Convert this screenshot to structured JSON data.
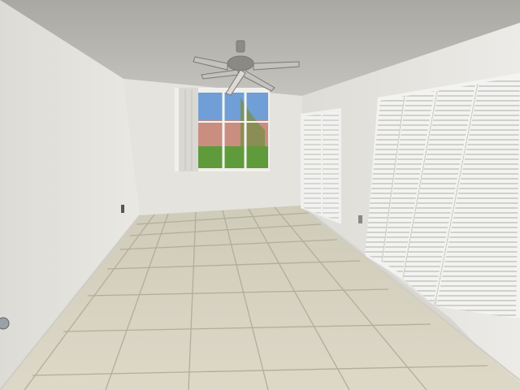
{
  "scene": {
    "ceiling_color": "#b9b8b3",
    "wall_color": "#e6e5e0",
    "wall_shadow_color": "#d4d3ce",
    "floor_color": "#d9d4c3",
    "grout_color": "#a8a393",
    "closet_color": "#f3f3f1",
    "louver_color": "#d2d2cf",
    "sky_color": "#6f9fd6",
    "lawn_color": "#5f9b3a",
    "building_color": "#c98e7f",
    "fan_color": "#8d8b86"
  },
  "icons": {
    "fan": "ceiling-fan-icon",
    "outlet": "wall-outlet-icon",
    "door_knob": "door-knob-icon"
  }
}
